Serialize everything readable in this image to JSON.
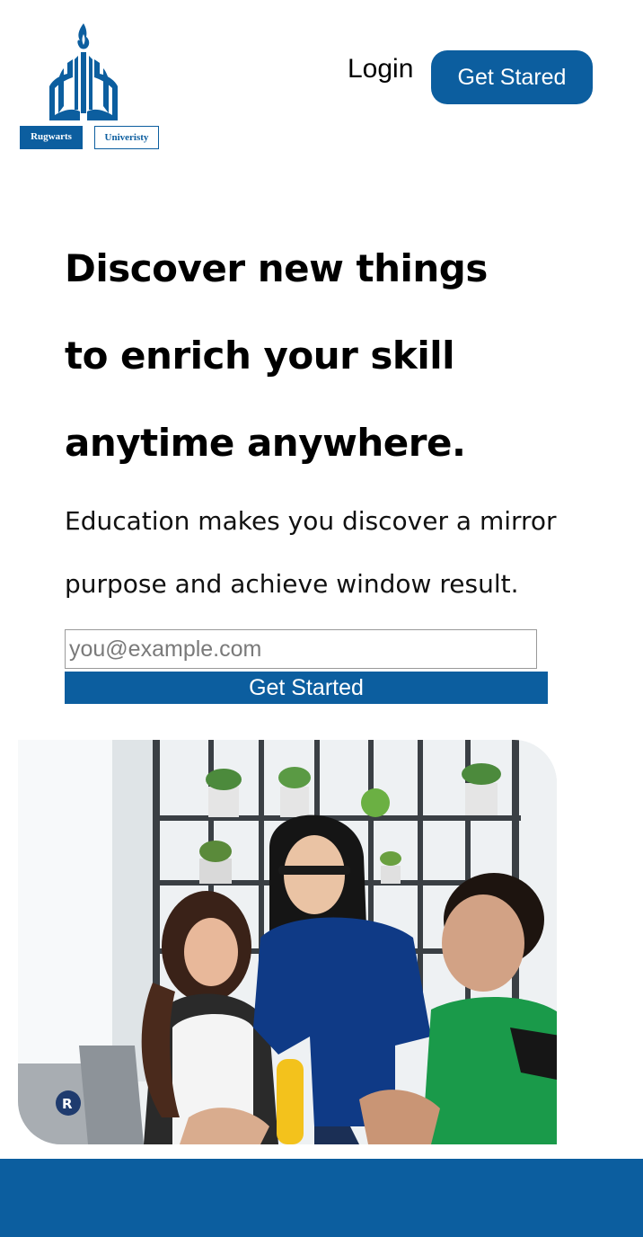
{
  "brand": {
    "name_left": "Rugwarts",
    "name_right": "Univeristy",
    "color": "#0c5e9f"
  },
  "header": {
    "login_label": "Login",
    "cta_label": "Get Stared"
  },
  "hero": {
    "title_lines": [
      "Discover new things",
      "to enrich your skill",
      "anytime anywhere."
    ],
    "subtitle_lines": [
      "Education makes you discover a mirror",
      "purpose and achieve window result."
    ]
  },
  "signup": {
    "email_placeholder": "you@example.com",
    "email_value": "",
    "button_label": "Get Started"
  },
  "photo": {
    "laptop_logo": "R"
  },
  "icons": {
    "logo": "flame-book-logo-icon"
  }
}
